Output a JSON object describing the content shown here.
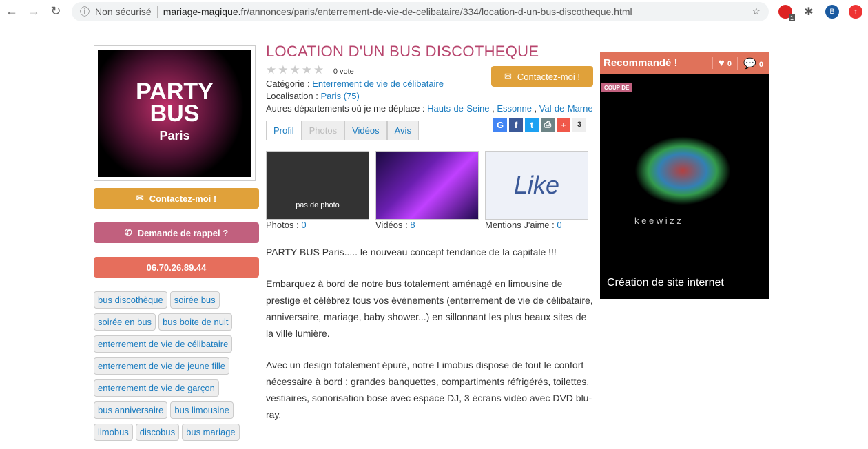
{
  "browser": {
    "security": "Non sécurisé",
    "domain": "mariage-magique.fr",
    "path": "/annonces/paris/enterrement-de-vie-de-celibataire/334/location-d-un-bus-discotheque.html",
    "ext_badge": "1",
    "profile": "B"
  },
  "left": {
    "logo": [
      "PARTY",
      "BUS",
      "Paris"
    ],
    "contact": "Contactez-moi !",
    "callback": "Demande de rappel ?",
    "phone": "06.70.26.89.44",
    "tags": [
      "bus discothèque",
      "soirée bus",
      "soirée en bus",
      "bus boite de nuit",
      "enterrement de vie de célibataire",
      "enterrement de vie de jeune fille",
      "enterrement de vie de garçon",
      "bus anniversaire",
      "bus limousine",
      "limobus",
      "discobus",
      "bus mariage"
    ]
  },
  "main": {
    "title": "LOCATION D'UN BUS DISCOTHEQUE",
    "stars": "★★★★★",
    "votes": "0 vote",
    "contact": "Contactez-moi !",
    "category_label": "Catégorie :",
    "category": "Enterrement de vie de célibataire",
    "location_label": "Localisation :",
    "location": "Paris (75)",
    "other_label": "Autres départements où je me déplace :",
    "other": [
      "Hauts-de-Seine",
      "Essonne",
      "Val-de-Marne"
    ],
    "tabs": [
      "Profil",
      "Photos",
      "Vidéos",
      "Avis"
    ],
    "share_count": "3",
    "media": [
      {
        "thumb": "pas de photo",
        "label": "Photos :",
        "count": "0"
      },
      {
        "label": "Vidéos :",
        "count": "8"
      },
      {
        "thumb": "Like",
        "label": "Mentions J'aime :",
        "count": "0"
      }
    ],
    "paragraphs": [
      "PARTY BUS Paris..... le nouveau concept tendance de la capitale !!!",
      "Embarquez à bord de notre bus totalement aménagé en limousine de prestige et célébrez tous vos événements (enterrement de vie de célibataire, anniversaire, mariage, baby shower...) en sillonnant les plus beaux sites de la ville lumière.",
      "Avec un design totalement épuré, notre Limobus dispose de tout le confort nécessaire à bord : grandes banquettes, compartiments réfrigérés, toilettes, vestiaires, sonorisation bose avec espace DJ, 3 écrans vidéo avec DVD blu-ray."
    ]
  },
  "right": {
    "title": "Recommandé !",
    "likes": "0",
    "comments": "0",
    "badge": "COUP DE",
    "brand": "k e e w i z z",
    "caption": "Création de site internet"
  }
}
